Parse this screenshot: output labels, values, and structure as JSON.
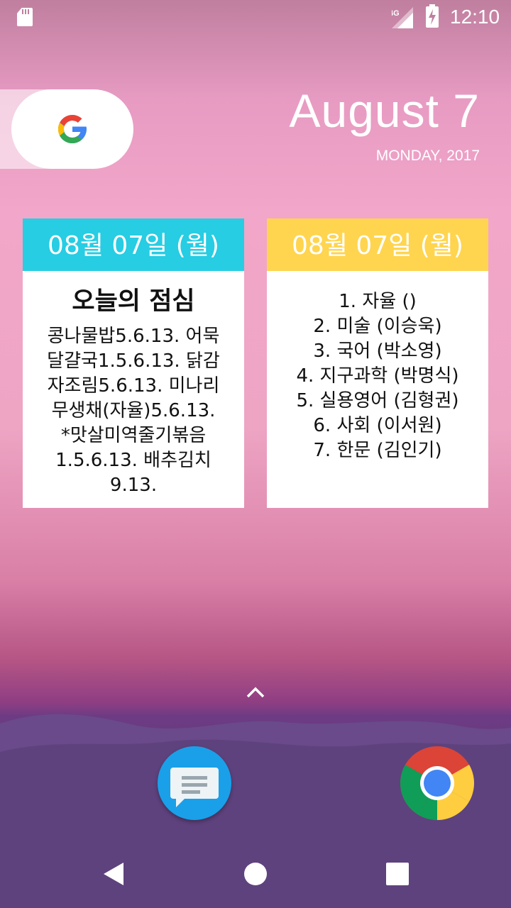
{
  "status_bar": {
    "network": "4G",
    "time": "12:10"
  },
  "date_widget": {
    "month_day": "August 7",
    "weekday_year": "MONDAY, 2017"
  },
  "lunch_widget": {
    "header": "08월 07일 (월)",
    "title": "오늘의 점심",
    "menu_lines": [
      "콩나물밥5.6.13.  어묵",
      "달걀국1.5.6.13.  닭감",
      "자조림5.6.13.  미나리",
      "무생채(자율)5.6.13.",
      "*맛살미역줄기볶음",
      "1.5.6.13.  배추김치",
      "9.13."
    ]
  },
  "schedule_widget": {
    "header": "08월 07일 (월)",
    "classes": [
      "1. 자율 ()",
      "2. 미술 (이승욱)",
      "3. 국어 (박소영)",
      "4. 지구과학 (박명식)",
      "5. 실용영어 (김형권)",
      "6. 사회 (이서원)",
      "7. 한문 (김인기)"
    ]
  },
  "dock": {
    "apps": [
      "messages-app-icon",
      "chrome-app-icon"
    ]
  },
  "colors": {
    "lunch_header": "#26cde3",
    "schedule_header": "#ffd54f"
  }
}
